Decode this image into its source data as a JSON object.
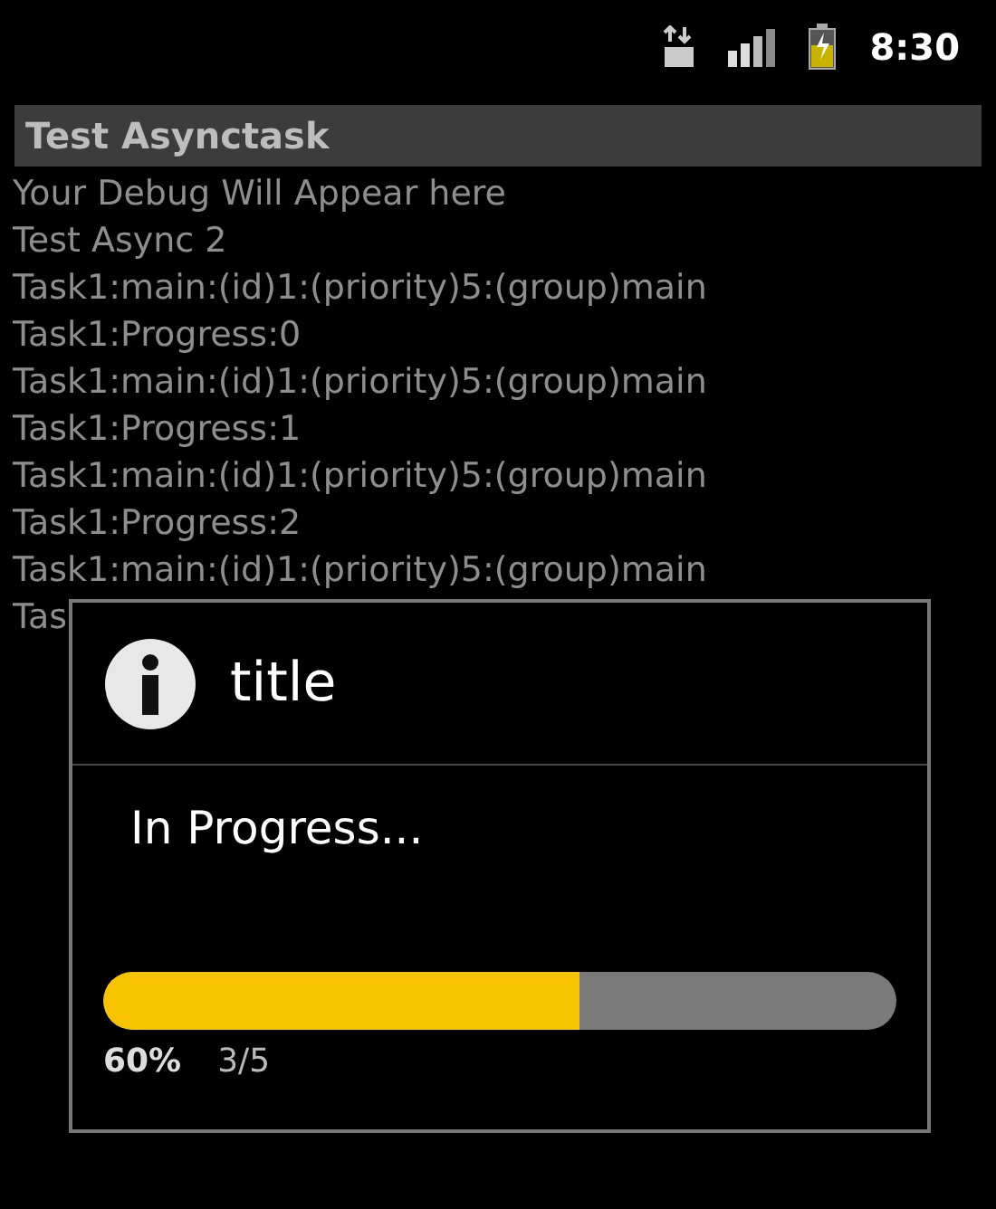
{
  "status_bar": {
    "time": "8:30"
  },
  "app_title": "Test Asynctask",
  "log_lines": [
    "Your Debug Will Appear here",
    "Test Async 2",
    "Task1:main:(id)1:(priority)5:(group)main",
    "Task1:Progress:0",
    "Task1:main:(id)1:(priority)5:(group)main",
    "Task1:Progress:1",
    "Task1:main:(id)1:(priority)5:(group)main",
    "Task1:Progress:2",
    "Task1:main:(id)1:(priority)5:(group)main",
    "Tas"
  ],
  "dialog": {
    "title": "title",
    "message": "In Progress...",
    "progress": {
      "level": 0.6,
      "percent": "60%",
      "count": "3/5"
    }
  }
}
